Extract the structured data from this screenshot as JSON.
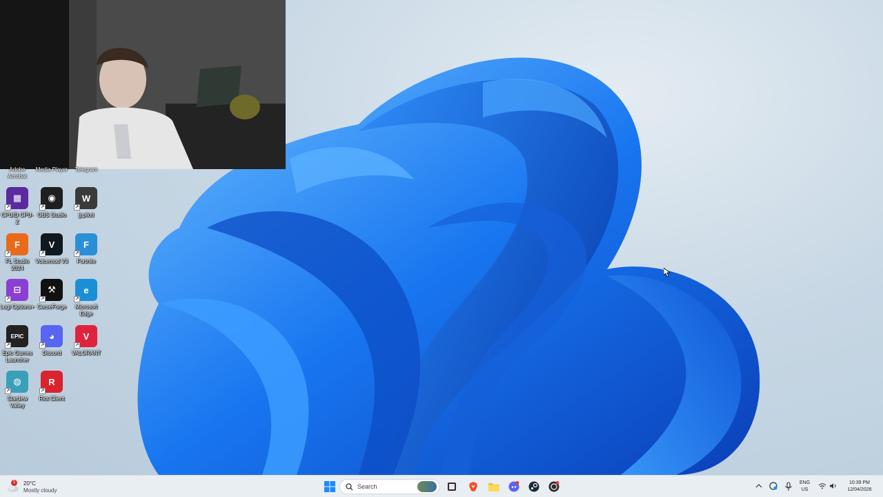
{
  "desktop": {
    "partial_labels": [
      "Adobe Acrobat",
      "Media Player",
      "Telegram"
    ],
    "icons": [
      {
        "label": "CPUID CPU-Z",
        "glyph": "▦",
        "color": "#5b2a9e"
      },
      {
        "label": "OBS Studio",
        "glyph": "◉",
        "color": "#1f1f1f"
      },
      {
        "label": "jj.piloti",
        "glyph": "W",
        "color": "#3a3a3a"
      },
      {
        "label": "FL Studio 2024",
        "glyph": "F",
        "color": "#e86b1c"
      },
      {
        "label": "Voicemod V3",
        "glyph": "V",
        "color": "#101820"
      },
      {
        "label": "Fortnite",
        "glyph": "F",
        "color": "#2b8fd8"
      },
      {
        "label": "Logi Options+",
        "glyph": "⊟",
        "color": "#8a3fd1"
      },
      {
        "label": "CurseForge",
        "glyph": "⚒",
        "color": "#111111"
      },
      {
        "label": "Microsoft Edge",
        "glyph": "e",
        "color": "#1b8fd6"
      },
      {
        "label": "Epic Games Launcher",
        "glyph": "EPIC",
        "color": "#222222"
      },
      {
        "label": "Discord",
        "glyph": "◕",
        "color": "#5865f2"
      },
      {
        "label": "VALORANT",
        "glyph": "V",
        "color": "#e0233d"
      },
      {
        "label": "Stardew Valley",
        "glyph": "◍",
        "color": "#3aa0b8"
      },
      {
        "label": "Riot Client",
        "glyph": "R",
        "color": "#d9232d"
      }
    ]
  },
  "taskbar": {
    "weather": {
      "temp": "20°C",
      "condition": "Mostly cloudy",
      "badge": "1"
    },
    "search": {
      "placeholder": "Search"
    },
    "start_icon": "windows-icon",
    "pinned": [
      "file-explorer-icon",
      "brave-icon",
      "folder-icon",
      "discord-icon",
      "steam-icon",
      "obs-icon"
    ],
    "tray": {
      "lang_line1": "ENG",
      "lang_line2": "US",
      "time": "10:39 PM",
      "date": "12/04/2026"
    }
  },
  "colors": {
    "taskbar_bg": "#e9eef3",
    "accent": "#0a6cff"
  }
}
